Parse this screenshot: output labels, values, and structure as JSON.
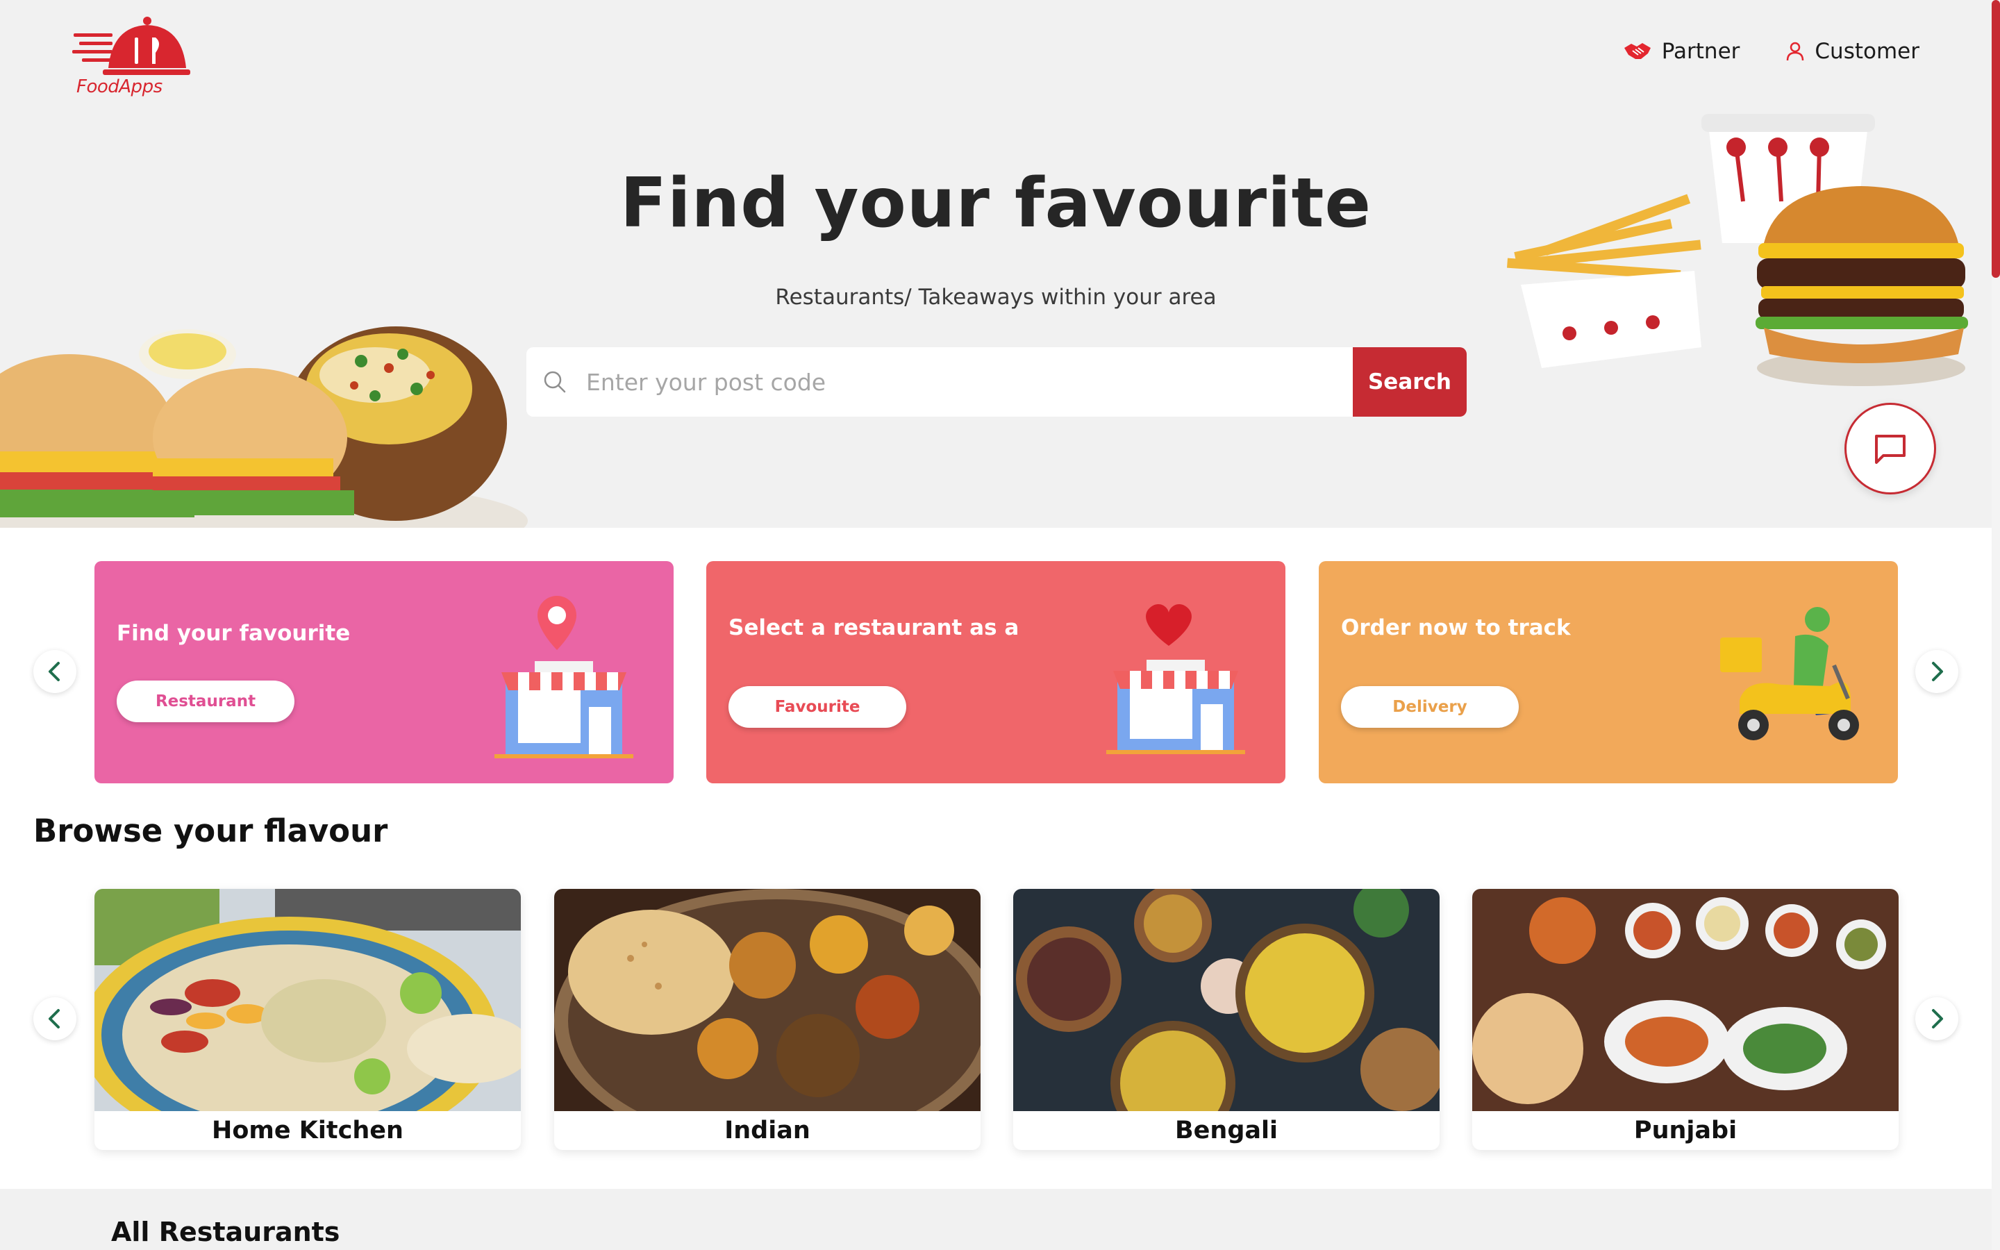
{
  "brand": {
    "name": "FoodApps",
    "primary": "#c62b33"
  },
  "nav": {
    "partner_label": "Partner",
    "partner_icon": "handshake-icon",
    "customer_label": "Customer",
    "customer_icon": "user-icon"
  },
  "hero": {
    "title": "Find your favourite",
    "subtitle": "Restaurants/ Takeaways within your area",
    "search_placeholder": "Enter your post code",
    "search_value": "",
    "search_button": "Search"
  },
  "promos": [
    {
      "title": "Find your favourite",
      "button": "Restaurant",
      "color": "#ea65a5",
      "icon": "store-pin-icon"
    },
    {
      "title": "Select a restaurant as a",
      "button": "Favourite",
      "color": "#f0666a",
      "icon": "store-heart-icon"
    },
    {
      "title": "Order now to track",
      "button": "Delivery",
      "color": "#f2a95a",
      "icon": "delivery-scooter-icon"
    }
  ],
  "browse": {
    "title": "Browse your flavour",
    "items": [
      {
        "label": "Home Kitchen"
      },
      {
        "label": "Indian"
      },
      {
        "label": "Bengali"
      },
      {
        "label": "Punjabi"
      }
    ]
  },
  "all_restaurants": {
    "title": "All Restaurants"
  }
}
